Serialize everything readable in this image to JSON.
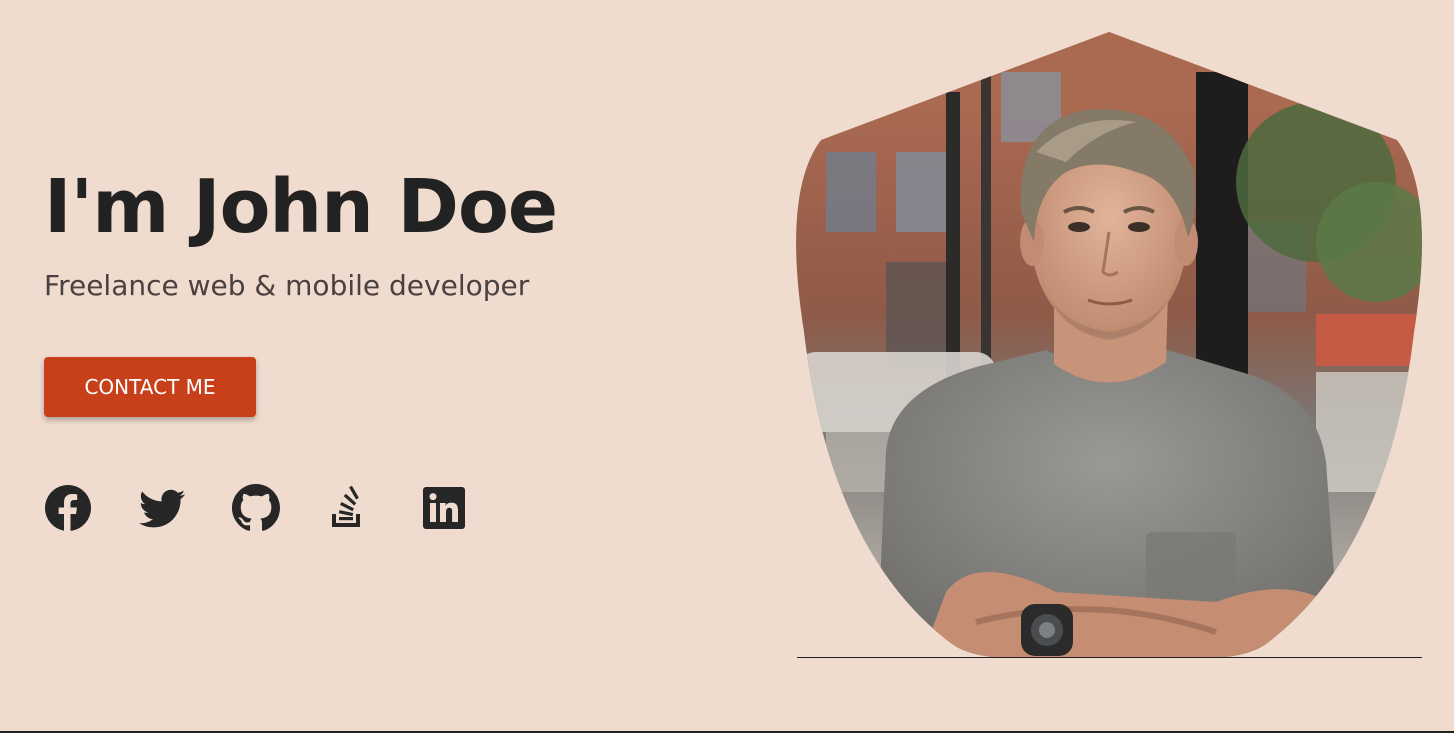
{
  "hero": {
    "title": "I'm John Doe",
    "subtitle": "Freelance web & mobile developer",
    "contact_label": "CONTACT ME"
  },
  "social": {
    "items": [
      {
        "name": "Facebook",
        "icon": "facebook-icon"
      },
      {
        "name": "Twitter",
        "icon": "twitter-icon"
      },
      {
        "name": "GitHub",
        "icon": "github-icon"
      },
      {
        "name": "Stack Overflow",
        "icon": "stackoverflow-icon"
      },
      {
        "name": "LinkedIn",
        "icon": "linkedin-icon"
      }
    ]
  },
  "photo": {
    "subject": "portrait photo of John Doe"
  },
  "colors": {
    "background": "#f0dbcf",
    "accent": "#c8401a",
    "text": "#222222"
  }
}
